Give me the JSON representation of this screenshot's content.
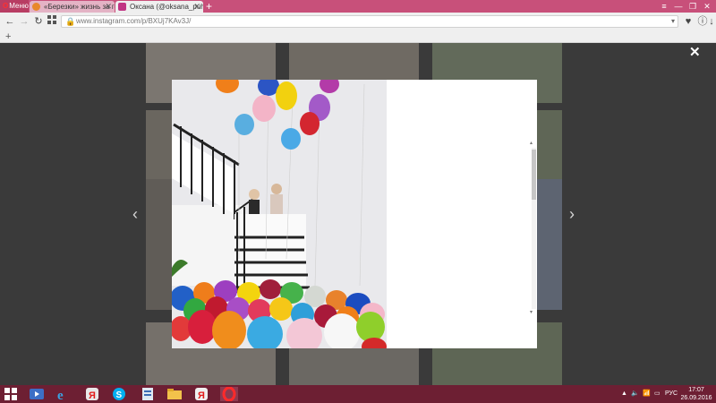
{
  "browser": {
    "menu_label": "Меню",
    "tabs": [
      {
        "label": "«Березки» жизнь за горо...",
        "close": "✕",
        "favicon_color": "#e8882b"
      },
      {
        "label": "Оксана (@oksana_puhova...",
        "close": "✕",
        "favicon_color": "#c13584"
      }
    ],
    "new_tab": "+",
    "window_controls": {
      "minimize": "—",
      "maximize": "❐",
      "close": "✕"
    },
    "url": "www.instagram.com/p/BXUj7KAv3J/",
    "lock": "🔒",
    "url_dropdown": "▾",
    "bookmarks_add": "+"
  },
  "page": {
    "close": "✕",
    "prev_arrow": "‹",
    "next_arrow": "›",
    "scroll_up": "▴",
    "scroll_down": "▾"
  },
  "taskbar": {
    "language": "РУС",
    "time": "17:07",
    "date": "26.09.2016",
    "tray_up": "▲"
  },
  "colors": {
    "titlebar": "#c8507a",
    "taskbar": "#6d1f33",
    "overlay": "#3a3a3a"
  }
}
